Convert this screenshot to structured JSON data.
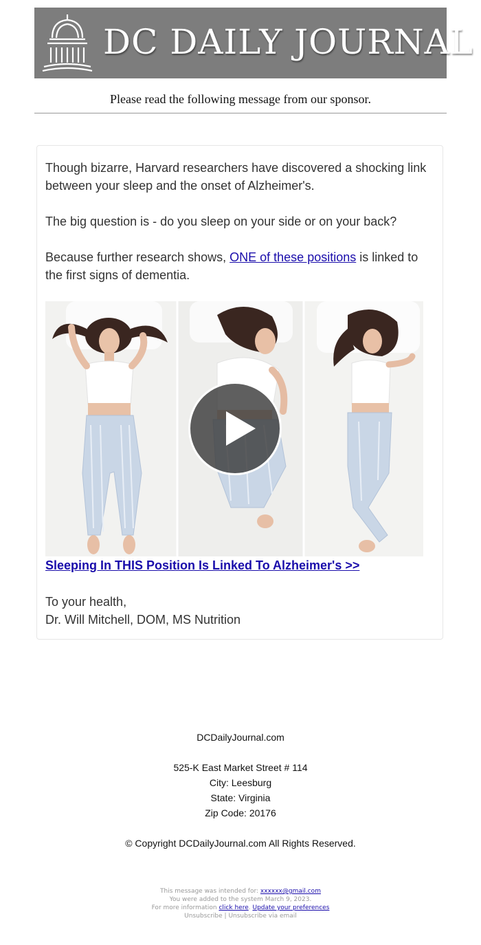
{
  "header": {
    "logo_icon": "capitol-dome-icon",
    "title": "DC DAILY JOURNAL",
    "background": "#7d7d7d"
  },
  "sponsor_notice": "Please read the following message from our sponsor.",
  "article": {
    "p1": "Though bizarre, Harvard researchers have discovered a shocking link between your sleep and the onset of Alzheimer's.",
    "p2": "The big question is - do you sleep on your side or on your back?",
    "p3_before": "Because further research shows, ",
    "p3_link": "ONE of these positions",
    "p3_after": " is linked to the first signs of dementia.",
    "video_icon": "play-icon",
    "cta_link": "Sleeping In THIS Position Is Linked To Alzheimer's >>",
    "signoff_line1": "To your health,",
    "signoff_line2": "Dr. Will Mitchell, DOM, MS Nutrition",
    "link_color": "#1a0dab"
  },
  "footer": {
    "site": "DCDailyJournal.com",
    "address": "525-K East Market Street # 114",
    "city": "City: Leesburg",
    "state": "State: Virginia",
    "zip": "Zip Code: 20176",
    "copyright": "© Copyright DCDailyJournal.com All Rights Reserved."
  },
  "fine_print": {
    "intended_prefix": "This message was intended for: ",
    "email": "xxxxxx@gmail.com",
    "added": "You were added to the system March 9, 2023.",
    "more_prefix": "For more information ",
    "click_here": "click here",
    "sep": ". ",
    "update_prefs": "Update your preferences",
    "unsubscribe": "Unsubscribe",
    "divider": " | ",
    "unsubscribe_email": "Unsubscribe via email"
  }
}
